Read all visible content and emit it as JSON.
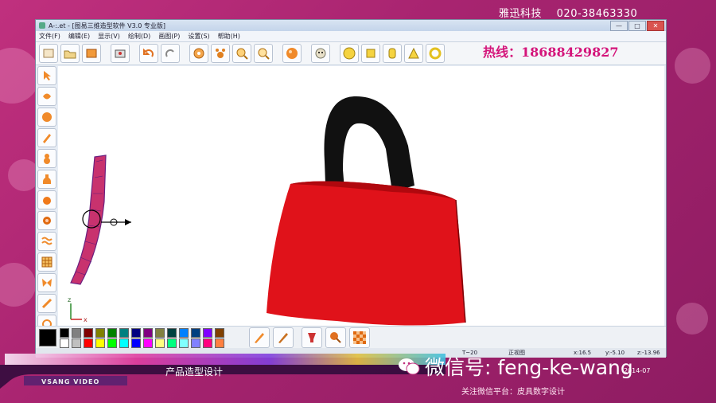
{
  "brand": {
    "company": "雅迅科技",
    "phone": "020-38463330"
  },
  "window": {
    "title": "A-:.et - [图易三维造型软件 V3.0 专业版]",
    "min": "—",
    "max": "□",
    "close": "✕"
  },
  "menu": [
    "文件(F)",
    "编辑(E)",
    "显示(V)",
    "绘制(D)",
    "画图(P)",
    "设置(S)",
    "帮助(H)"
  ],
  "toolbar_icons": [
    "new-icon",
    "open-icon",
    "save-icon",
    "print-icon",
    "undo-icon",
    "redo-icon",
    "gear-icon",
    "paw-icon",
    "zoom-in-icon",
    "zoom-out-icon",
    "sphere-icon",
    "dog-icon",
    "circle-icon",
    "cube-icon",
    "cylinder-icon",
    "cone-icon",
    "torus-icon"
  ],
  "hotline": "热线：18688429827",
  "left_tool_icons": [
    "pointer-icon",
    "shape-icon",
    "sphere-icon",
    "brush-icon",
    "gourd-icon",
    "bottle-icon",
    "orange-icon",
    "orange-icon",
    "wave-icon",
    "grid-icon",
    "butterfly-icon",
    "line-icon",
    "circle-icon"
  ],
  "axes": {
    "z": "z",
    "x": "x"
  },
  "palette": {
    "colors": [
      "#000000",
      "#808080",
      "#800000",
      "#808000",
      "#008000",
      "#008080",
      "#000080",
      "#800080",
      "#808040",
      "#004040",
      "#0080ff",
      "#004080",
      "#8000ff",
      "#804000",
      "#ffffff",
      "#c0c0c0",
      "#ff0000",
      "#ffff00",
      "#00ff00",
      "#00ffff",
      "#0000ff",
      "#ff00ff",
      "#ffff80",
      "#00ff80",
      "#80ffff",
      "#8080ff",
      "#ff0080",
      "#ff8040"
    ]
  },
  "palette_tools": [
    "brush-icon",
    "brush-icon",
    "cup-icon",
    "drumstick-icon",
    "checker-icon"
  ],
  "status": {
    "left": "T~20",
    "mode": "正视图",
    "x": "x:16.5",
    "y": "y:-5.10",
    "z": "z:-13.96",
    "date": "2014-07"
  },
  "video": {
    "brand": "VSANG VIDEO",
    "caption": "产品造型设计"
  },
  "wechat": {
    "handle": "微信号: feng-ke-wang",
    "follow": "关注微信平台：皮具数字设计"
  }
}
